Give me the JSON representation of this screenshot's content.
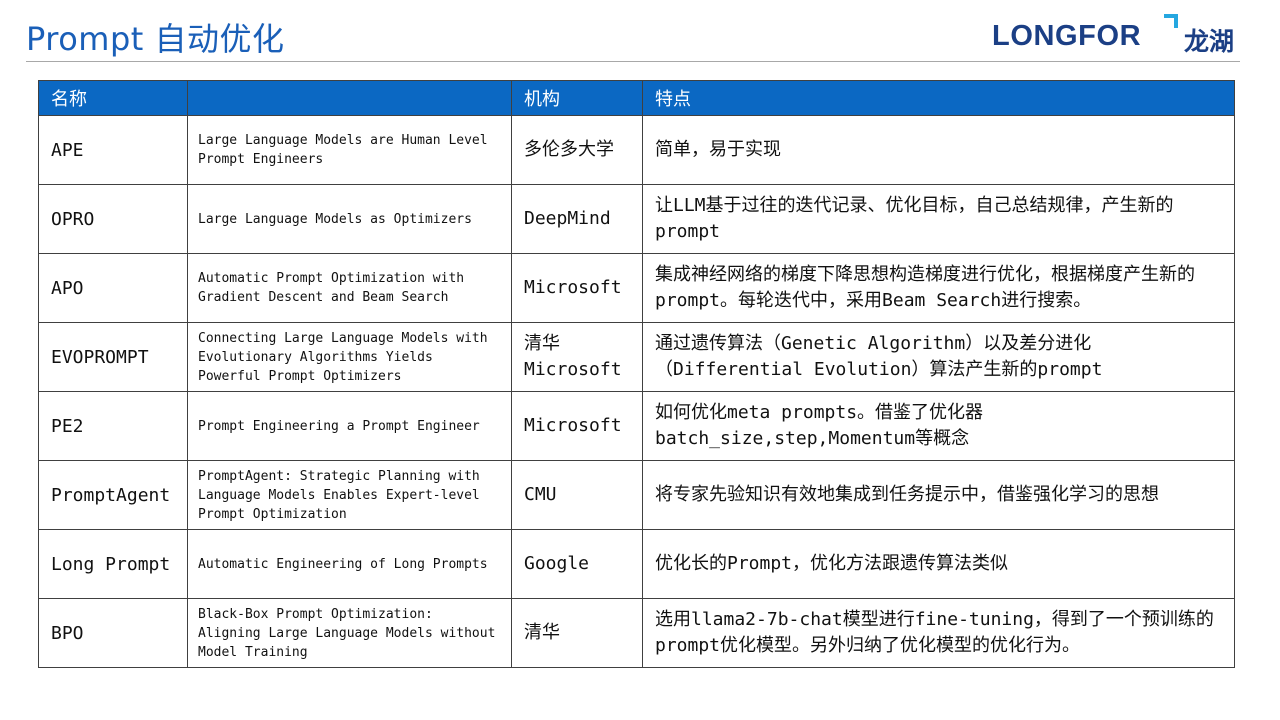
{
  "title": "Prompt 自动优化",
  "logo": {
    "latin": "LONGFOR",
    "cjk": "龙湖"
  },
  "table": {
    "headers": [
      "名称",
      "",
      "机构",
      "特点"
    ],
    "rows": [
      {
        "name": "APE",
        "paper": "Large Language Models are Human Level Prompt Engineers",
        "org": "多伦多大学",
        "feature": "简单，易于实现"
      },
      {
        "name": "OPRO",
        "paper": "Large Language Models as Optimizers",
        "org": "DeepMind",
        "feature": "让LLM基于过往的迭代记录、优化目标，自己总结规律，产生新的prompt"
      },
      {
        "name": "APO",
        "paper": "Automatic Prompt Optimization with Gradient Descent and Beam Search",
        "org": "Microsoft",
        "feature": "集成神经网络的梯度下降思想构造梯度进行优化，根据梯度产生新的prompt。每轮迭代中，采用Beam Search进行搜索。"
      },
      {
        "name": "EVOPROMPT",
        "paper": "Connecting Large Language Models with Evolutionary Algorithms Yields Powerful Prompt Optimizers",
        "org": "清华 Microsoft",
        "feature": "通过遗传算法（Genetic Algorithm）以及差分进化（Differential Evolution）算法产生新的prompt"
      },
      {
        "name": "PE2",
        "paper": "Prompt Engineering a Prompt Engineer",
        "org": "Microsoft",
        "feature": "如何优化meta prompts。借鉴了优化器batch_size,step,Momentum等概念"
      },
      {
        "name": "PromptAgent",
        "paper": "PromptAgent: Strategic Planning with Language Models Enables Expert-level Prompt Optimization",
        "org": "CMU",
        "feature": "将专家先验知识有效地集成到任务提示中，借鉴强化学习的思想"
      },
      {
        "name": "Long Prompt",
        "paper": "Automatic Engineering of Long Prompts",
        "org": "Google",
        "feature": "优化长的Prompt，优化方法跟遗传算法类似"
      },
      {
        "name": "BPO",
        "paper": "Black-Box Prompt Optimization: Aligning Large Language Models without Model Training",
        "org": "清华",
        "feature": "选用llama2-7b-chat模型进行fine-tuning，得到了一个预训练的prompt优化模型。另外归纳了优化模型的优化行为。"
      }
    ]
  }
}
